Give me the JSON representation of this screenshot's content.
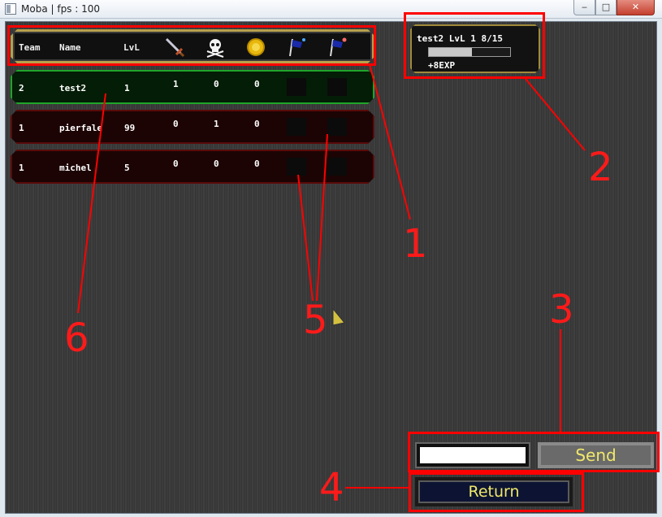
{
  "window": {
    "title": "Moba | fps : 100",
    "controls": {
      "minimize": "‒",
      "maximize": "□",
      "close": "✕"
    }
  },
  "scoreboard": {
    "headers": {
      "team": "Team",
      "name": "Name",
      "level": "LvL"
    },
    "header_icons": [
      "sword-icon",
      "skull-icon",
      "gold-coin-icon",
      "blue-flag-icon",
      "red-flag-icon"
    ],
    "rows": [
      {
        "team": "2",
        "name": "test2",
        "level": "1",
        "kills": "1",
        "deaths": "0",
        "gold": "0",
        "status": "ally"
      },
      {
        "team": "1",
        "name": "pierfale",
        "level": "99",
        "kills": "0",
        "deaths": "1",
        "gold": "0",
        "status": "enemy"
      },
      {
        "team": "1",
        "name": "michel",
        "level": "5",
        "kills": "0",
        "deaths": "0",
        "gold": "0",
        "status": "enemy"
      }
    ]
  },
  "player_status": {
    "summary": "test2 LvL 1 8/15",
    "xp_progress": 0.53,
    "xp_gain": "+8EXP"
  },
  "chat": {
    "input_value": "",
    "send_label": "Send"
  },
  "return_label": "Return",
  "annotations": {
    "box_color": "#ff0000",
    "labels": [
      "1",
      "2",
      "3",
      "4",
      "5",
      "6"
    ]
  },
  "colors": {
    "ally_border": "#1fa52a",
    "enemy_border": "#5a0a0a",
    "button_text": "#f0e86a"
  }
}
